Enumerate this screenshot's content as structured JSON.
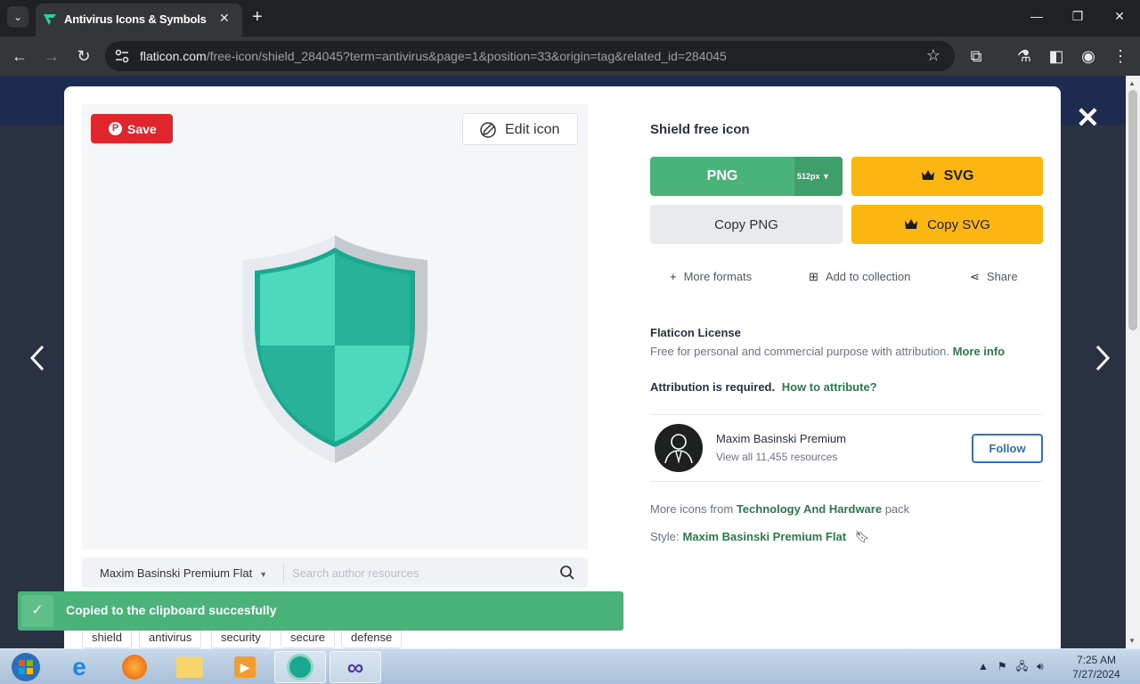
{
  "browser": {
    "tab_title": "Antivirus Icons & Symbols",
    "url_domain": "flaticon.com",
    "url_path": "/free-icon/shield_284045?term=antivirus&page=1&position=33&origin=tag&related_id=284045"
  },
  "preview": {
    "save_label": "Save",
    "edit_label": "Edit icon",
    "author_select": "Maxim Basinski Premium Flat",
    "search_placeholder": "Search author resources",
    "tags": [
      "shield",
      "antivirus",
      "security",
      "secure",
      "defense"
    ]
  },
  "details": {
    "title": "Shield free icon",
    "png_label": "PNG",
    "png_size": "512px",
    "svg_label": "SVG",
    "copy_png_label": "Copy PNG",
    "copy_svg_label": "Copy SVG",
    "more_formats": "More formats",
    "add_collection": "Add to collection",
    "share": "Share",
    "license_title": "Flaticon License",
    "license_desc": "Free for personal and commercial purpose with attribution.",
    "more_info": "More info",
    "attribution": "Attribution is required.",
    "how_attribute": "How to attribute?",
    "author_name": "Maxim Basinski Premium",
    "author_resources": "View all 11,455 resources",
    "follow_label": "Follow",
    "more_icons_prefix": "More icons from",
    "pack_name": "Technology And Hardware",
    "pack_suffix": "pack",
    "style_label": "Style:",
    "style_name": "Maxim Basinski Premium Flat"
  },
  "toast": {
    "message": "Copied to the clipboard succesfully"
  },
  "taskbar": {
    "time": "7:25 AM",
    "date": "7/27/2024"
  },
  "colors": {
    "png_green": "#4ab37a",
    "svg_yellow": "#fbb612",
    "save_red": "#e0262c",
    "link_green": "#2c7a4b",
    "follow_blue": "#2e71c9"
  }
}
